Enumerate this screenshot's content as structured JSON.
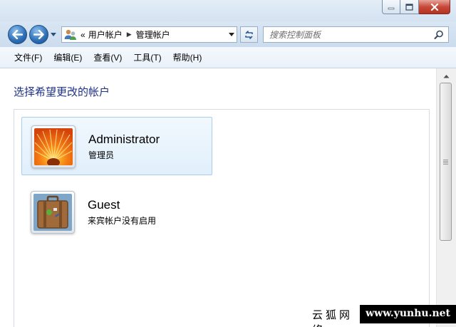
{
  "window": {
    "accent": "#1e3287",
    "caption_icons": [
      "minimize-icon",
      "maximize-icon",
      "close-icon"
    ]
  },
  "address_bar": {
    "overflow": "«",
    "crumbs": [
      "用户帐户",
      "管理帐户"
    ]
  },
  "search": {
    "placeholder": "搜索控制面板"
  },
  "menu": {
    "items": [
      "文件(F)",
      "编辑(E)",
      "查看(V)",
      "工具(T)",
      "帮助(H)"
    ]
  },
  "main": {
    "heading": "选择希望更改的帐户",
    "accounts": [
      {
        "name": "Administrator",
        "type": "管理员",
        "picture": "orange-flower-icon",
        "selected": true
      },
      {
        "name": "Guest",
        "type": "来宾帐户没有启用",
        "picture": "suitcase-icon",
        "selected": false
      }
    ]
  },
  "watermark": {
    "left": "云狐网络",
    "right": "www.yunhu.net"
  }
}
